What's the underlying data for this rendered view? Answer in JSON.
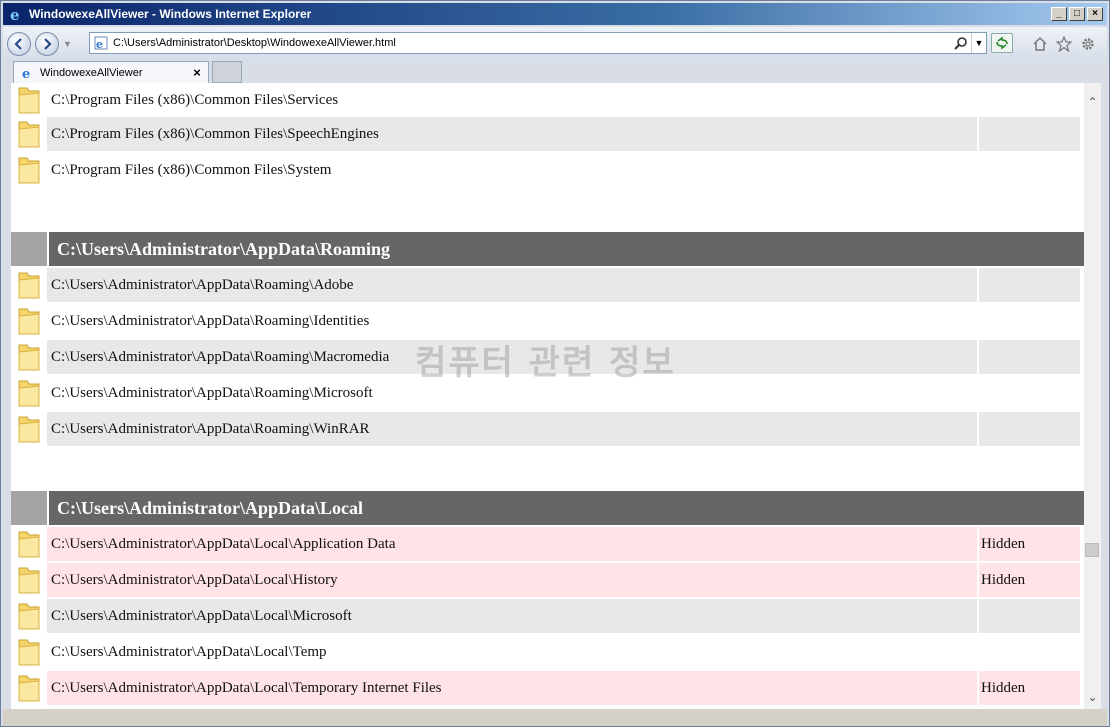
{
  "window": {
    "title": "WindowexeAllViewer - Windows Internet Explorer",
    "controls": [
      "_",
      "□",
      "×"
    ]
  },
  "address_bar": {
    "url": "C:\\Users\\Administrator\\Desktop\\WindowexeAllViewer.html"
  },
  "tab": {
    "label": "WindowexeAllViewer",
    "close": "×"
  },
  "watermark": "컴퓨터 관련 정보",
  "content": {
    "group_top": {
      "rows": [
        {
          "path": "C:\\Program Files (x86)\\Common Files\\Services",
          "attr": ""
        },
        {
          "path": "C:\\Program Files (x86)\\Common Files\\SpeechEngines",
          "attr": ""
        },
        {
          "path": "C:\\Program Files (x86)\\Common Files\\System",
          "attr": ""
        }
      ]
    },
    "group_roaming": {
      "header": "C:\\Users\\Administrator\\AppData\\Roaming",
      "rows": [
        {
          "path": "C:\\Users\\Administrator\\AppData\\Roaming\\Adobe",
          "attr": ""
        },
        {
          "path": "C:\\Users\\Administrator\\AppData\\Roaming\\Identities",
          "attr": ""
        },
        {
          "path": "C:\\Users\\Administrator\\AppData\\Roaming\\Macromedia",
          "attr": ""
        },
        {
          "path": "C:\\Users\\Administrator\\AppData\\Roaming\\Microsoft",
          "attr": ""
        },
        {
          "path": "C:\\Users\\Administrator\\AppData\\Roaming\\WinRAR",
          "attr": ""
        }
      ]
    },
    "group_local": {
      "header": "C:\\Users\\Administrator\\AppData\\Local",
      "rows": [
        {
          "path": "C:\\Users\\Administrator\\AppData\\Local\\Application Data",
          "attr": "Hidden"
        },
        {
          "path": "C:\\Users\\Administrator\\AppData\\Local\\History",
          "attr": "Hidden"
        },
        {
          "path": "C:\\Users\\Administrator\\AppData\\Local\\Microsoft",
          "attr": ""
        },
        {
          "path": "C:\\Users\\Administrator\\AppData\\Local\\Temp",
          "attr": ""
        },
        {
          "path": "C:\\Users\\Administrator\\AppData\\Local\\Temporary Internet Files",
          "attr": "Hidden"
        }
      ]
    }
  },
  "icons": {
    "folder": "folder-icon",
    "browser": "ie-icon",
    "home": "home-icon",
    "favorites": "star-icon",
    "tools": "gear-icon",
    "search": "search-icon",
    "refresh": "refresh-icon"
  },
  "colors": {
    "header_bg": "#666666",
    "header_block": "#a4a4a4",
    "row_grey": "#e8e8e8",
    "row_hidden": "#ffe3e6"
  }
}
